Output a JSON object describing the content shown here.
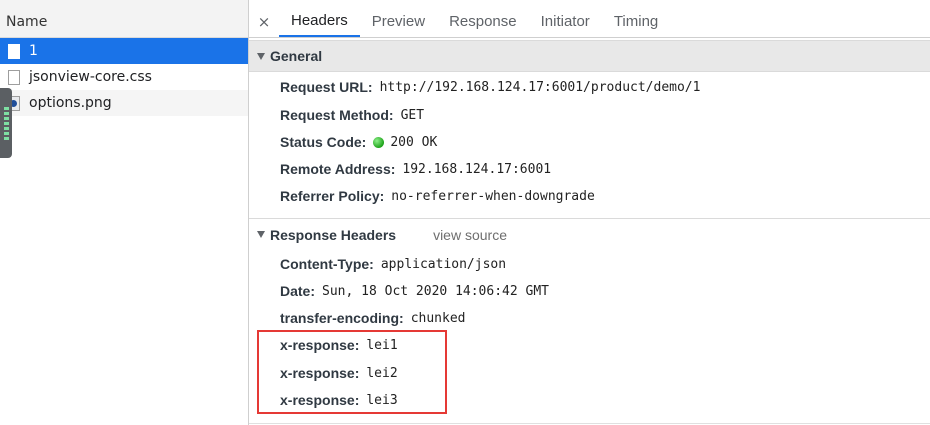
{
  "left_panel": {
    "column_header": "Name",
    "requests": [
      {
        "name": "1",
        "icon": "document-icon",
        "selected": true
      },
      {
        "name": "jsonview-core.css",
        "icon": "document-icon",
        "selected": false
      },
      {
        "name": "options.png",
        "icon": "image-icon",
        "selected": false
      }
    ]
  },
  "right_panel": {
    "close_label": "×",
    "tabs": [
      "Headers",
      "Preview",
      "Response",
      "Initiator",
      "Timing"
    ],
    "active_tab": "Headers",
    "general": {
      "title": "General",
      "rows": [
        {
          "key": "Request URL:",
          "value": "http://192.168.124.17:6001/product/demo/1"
        },
        {
          "key": "Request Method:",
          "value": "GET"
        },
        {
          "key": "Status Code:",
          "value": "200 OK"
        },
        {
          "key": "Remote Address:",
          "value": "192.168.124.17:6001"
        },
        {
          "key": "Referrer Policy:",
          "value": "no-referrer-when-downgrade"
        }
      ]
    },
    "response_headers": {
      "title": "Response Headers",
      "view_source": "view source",
      "rows": [
        {
          "key": "Content-Type:",
          "value": "application/json"
        },
        {
          "key": "Date:",
          "value": "Sun, 18 Oct 2020 14:06:42 GMT"
        },
        {
          "key": "transfer-encoding:",
          "value": "chunked"
        },
        {
          "key": "x-response:",
          "value": "lei1"
        },
        {
          "key": "x-response:",
          "value": "lei2"
        },
        {
          "key": "x-response:",
          "value": "lei3"
        }
      ]
    }
  },
  "colors": {
    "selected_row": "#1a73e8",
    "status_ok": "#1ea31a",
    "highlight_box": "#e53935"
  }
}
